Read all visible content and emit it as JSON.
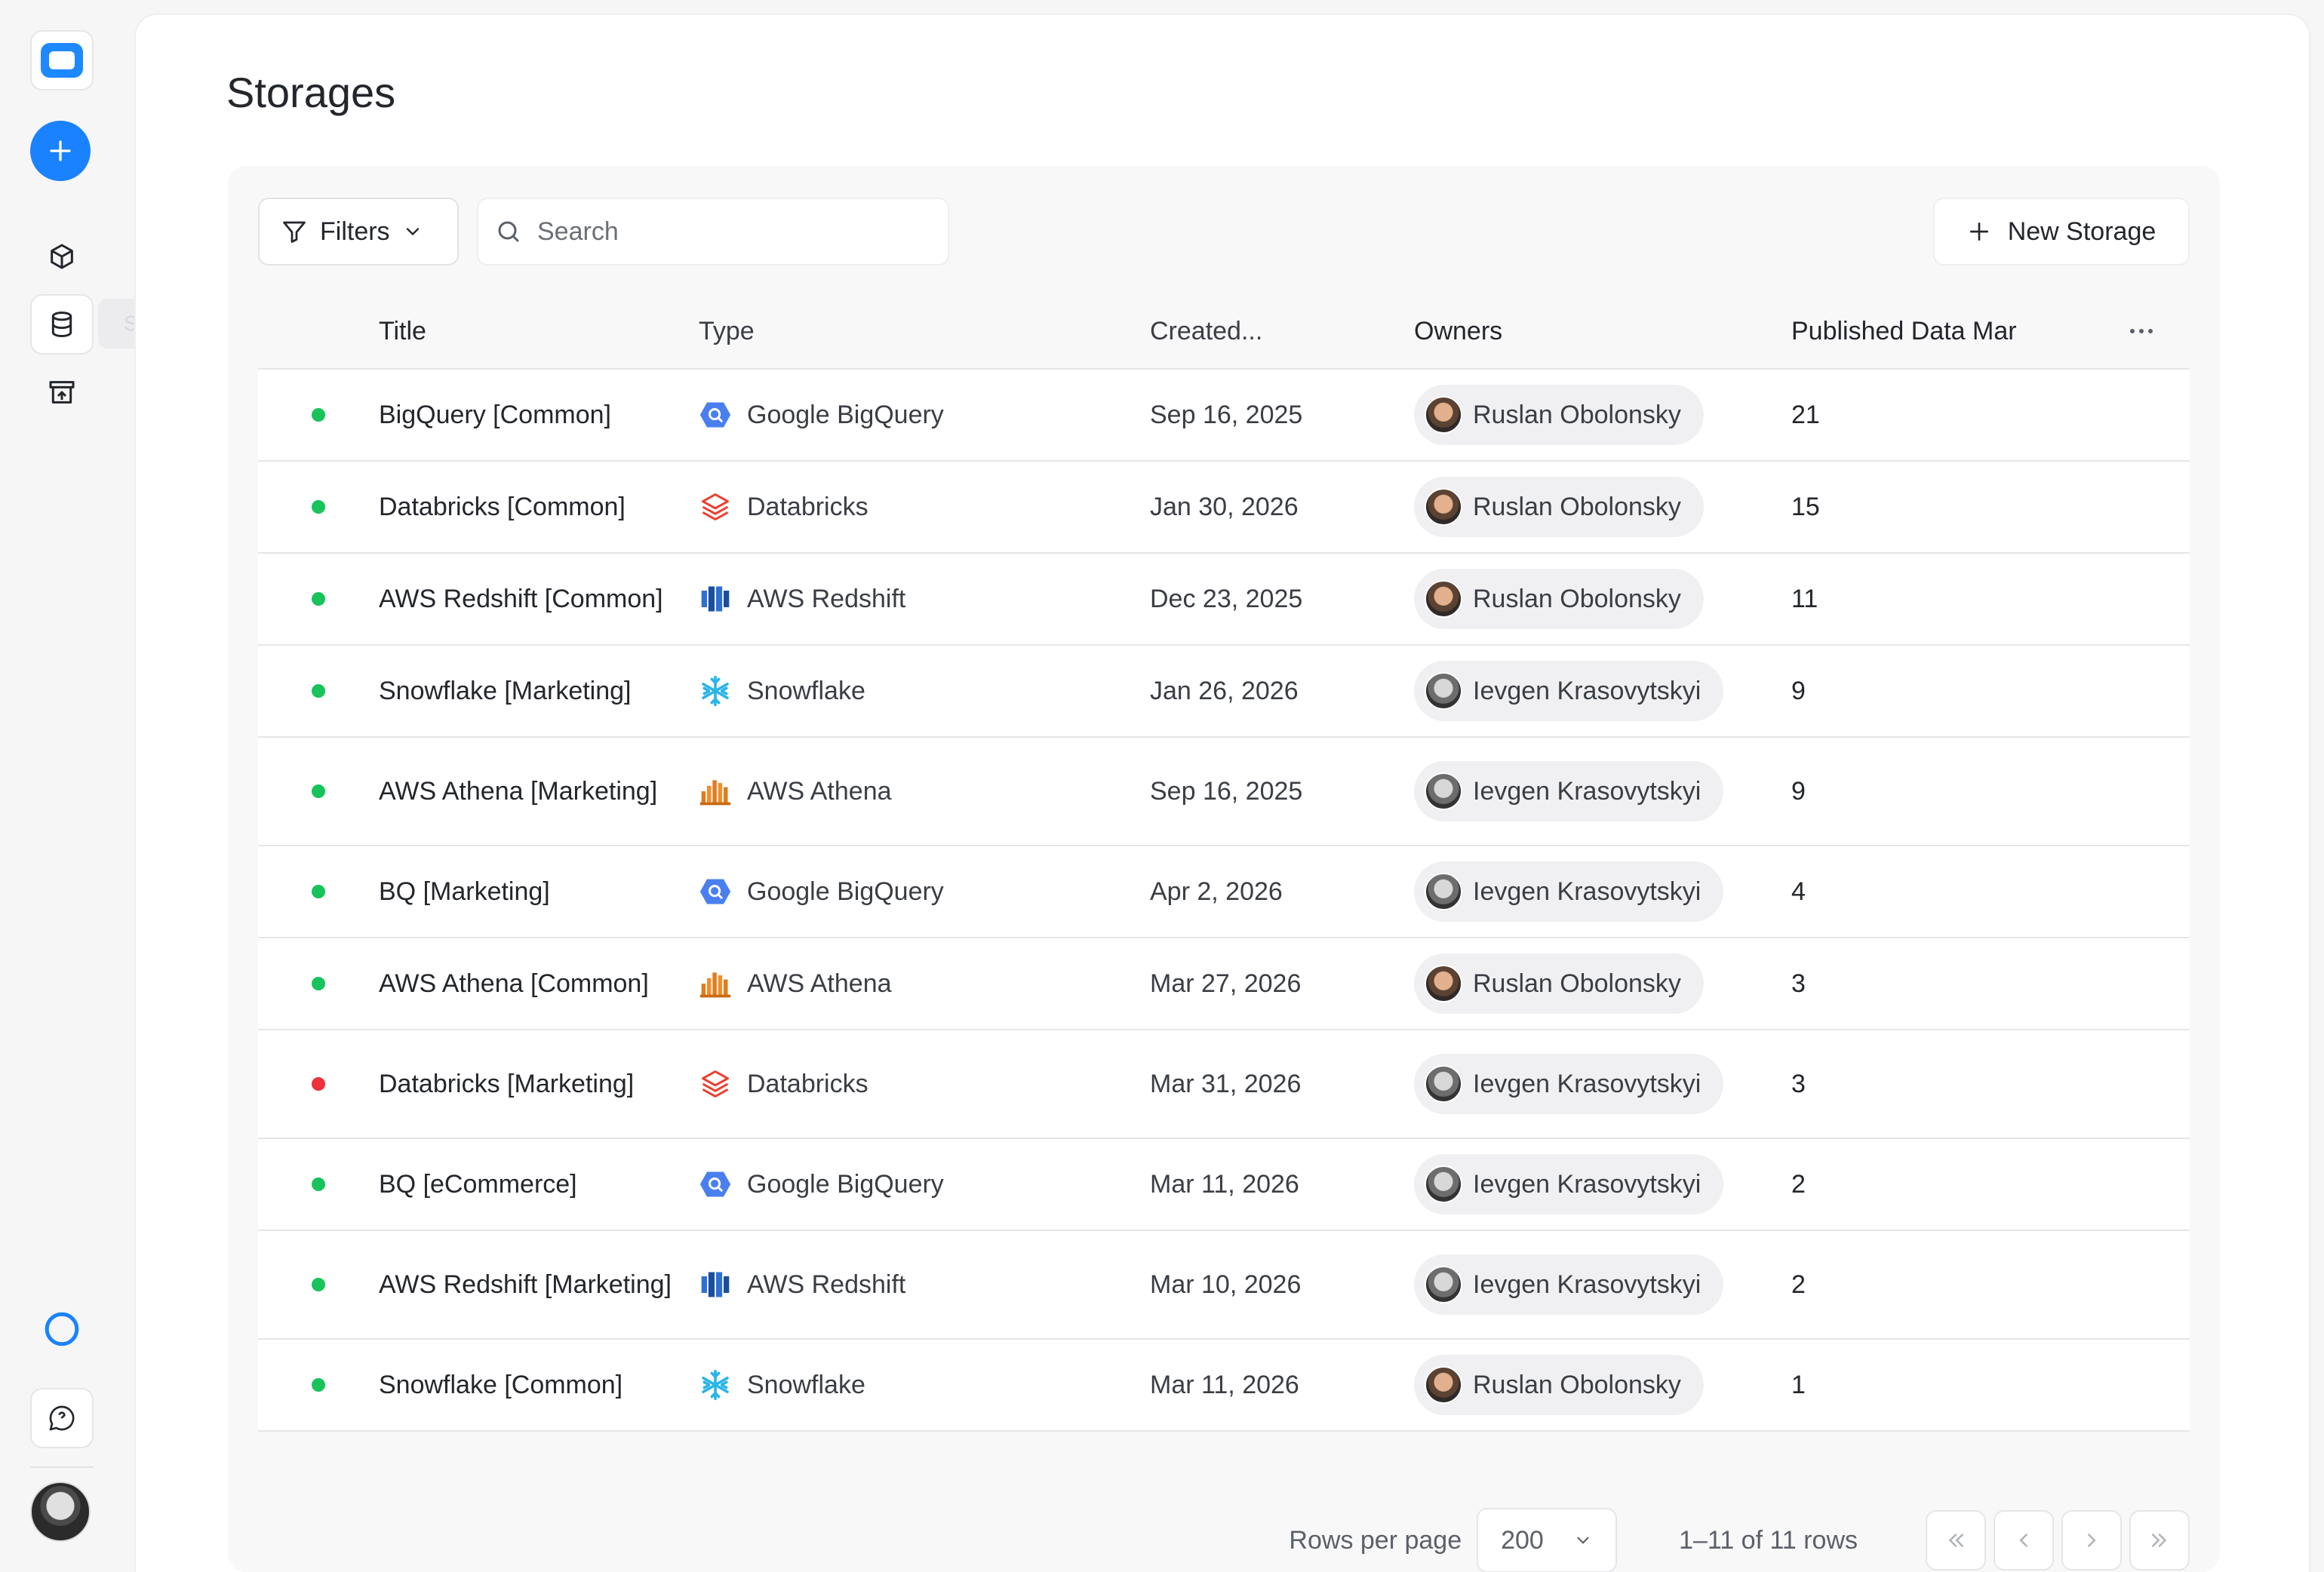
{
  "sidebar": {
    "tooltip": "Storages",
    "icons": [
      "logo-icon",
      "plus-icon",
      "box-icon",
      "database-icon",
      "store-icon",
      "ring-icon",
      "chat-icon",
      "avatar"
    ]
  },
  "page": {
    "title": "Storages"
  },
  "toolbar": {
    "filters_label": "Filters",
    "search_placeholder": "Search",
    "new_storage_label": "New Storage"
  },
  "table": {
    "headers": {
      "title": "Title",
      "type": "Type",
      "created": "Created...",
      "owners": "Owners",
      "published": "Published Data Mar"
    },
    "rows": [
      {
        "status": "active",
        "title": "BigQuery [Common]",
        "type": "Google BigQuery",
        "type_icon": "bigquery",
        "created": "Sep 16, 2025",
        "owner": "Ruslan Obolonsky",
        "published": "21"
      },
      {
        "status": "active",
        "title": "Databricks [Common]",
        "type": "Databricks",
        "type_icon": "databricks",
        "created": "Jan 30, 2026",
        "owner": "Ruslan Obolonsky",
        "published": "15"
      },
      {
        "status": "active",
        "title": "AWS Redshift [Common]",
        "type": "AWS Redshift",
        "type_icon": "redshift",
        "created": "Dec 23, 2025",
        "owner": "Ruslan Obolonsky",
        "published": "11"
      },
      {
        "status": "active",
        "title": "Snowflake [Marketing]",
        "type": "Snowflake",
        "type_icon": "snowflake",
        "created": "Jan 26, 2026",
        "owner": "Ievgen Krasovytskyi",
        "published": "9"
      },
      {
        "status": "active",
        "title": "AWS Athena [Marketing]",
        "type": "AWS Athena",
        "type_icon": "athena",
        "created": "Sep 16, 2025",
        "owner": "Ievgen Krasovytskyi",
        "published": "9"
      },
      {
        "status": "active",
        "title": "BQ [Marketing]",
        "type": "Google BigQuery",
        "type_icon": "bigquery",
        "created": "Apr 2, 2026",
        "owner": "Ievgen Krasovytskyi",
        "published": "4"
      },
      {
        "status": "active",
        "title": "AWS Athena [Common]",
        "type": "AWS Athena",
        "type_icon": "athena",
        "created": "Mar 27, 2026",
        "owner": "Ruslan Obolonsky",
        "published": "3"
      },
      {
        "status": "error",
        "title": "Databricks [Marketing]",
        "type": "Databricks",
        "type_icon": "databricks",
        "created": "Mar 31, 2026",
        "owner": "Ievgen Krasovytskyi",
        "published": "3"
      },
      {
        "status": "active",
        "title": "BQ [eCommerce]",
        "type": "Google BigQuery",
        "type_icon": "bigquery",
        "created": "Mar 11, 2026",
        "owner": "Ievgen Krasovytskyi",
        "published": "2"
      },
      {
        "status": "active",
        "title": "AWS Redshift [Marketing]",
        "type": "AWS Redshift",
        "type_icon": "redshift",
        "created": "Mar 10, 2026",
        "owner": "Ievgen Krasovytskyi",
        "published": "2"
      },
      {
        "status": "active",
        "title": "Snowflake [Common]",
        "type": "Snowflake",
        "type_icon": "snowflake",
        "created": "Mar 11, 2026",
        "owner": "Ruslan Obolonsky",
        "published": "1"
      }
    ]
  },
  "pagination": {
    "rows_per_page_label": "Rows per page",
    "rows_per_page_value": "200",
    "range_text": "1–11 of 11 rows"
  },
  "colors": {
    "accent": "#1a82ff",
    "status_active": "#17c35a",
    "status_error": "#f0303a"
  }
}
